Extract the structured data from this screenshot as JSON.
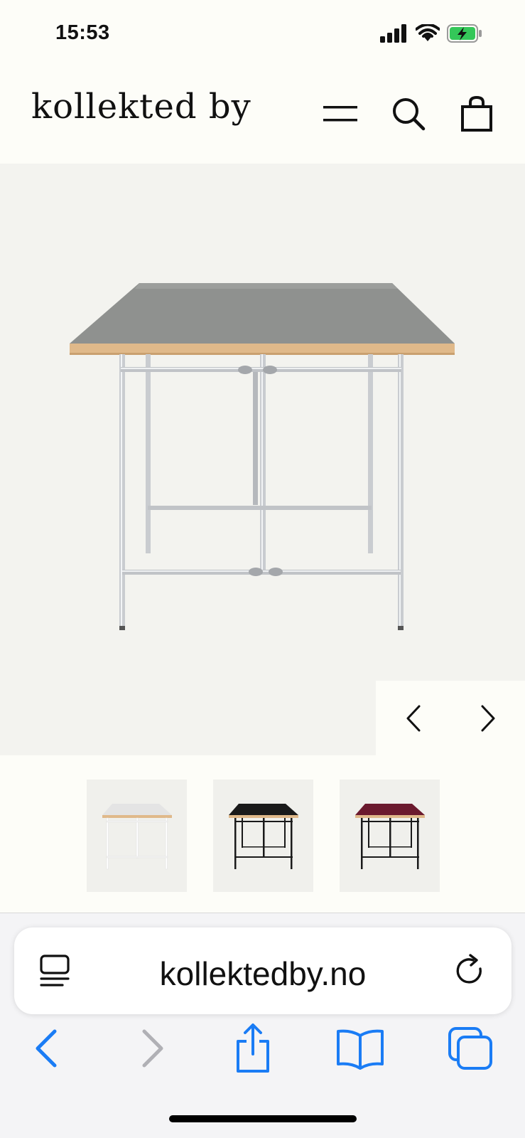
{
  "status_bar": {
    "time": "15:53",
    "icons": [
      "signal-icon",
      "wifi-icon",
      "battery-charging-icon"
    ]
  },
  "header": {
    "logo": "kollekted by",
    "icons": [
      "menu-icon",
      "search-icon",
      "shopping-bag-icon"
    ]
  },
  "gallery": {
    "prev_icon": "chevron-left-icon",
    "next_icon": "chevron-right-icon",
    "thumbnails": [
      {
        "label": "white-table",
        "top_color": "#e6e6e6",
        "frame_color": "#ffffff"
      },
      {
        "label": "black-table",
        "top_color": "#1a1a1a",
        "frame_color": "#1a1a1a"
      },
      {
        "label": "burgundy-table",
        "top_color": "#6b1a2e",
        "frame_color": "#1a1a1a"
      }
    ]
  },
  "browser": {
    "url": "kollektedby.no",
    "left_icon": "reader-icon",
    "right_icon": "reload-icon",
    "toolbar": [
      "back-icon",
      "forward-icon",
      "share-icon",
      "bookmarks-icon",
      "tabs-icon"
    ]
  },
  "colors": {
    "accent": "#1a7cf5",
    "disabled": "#b0b0b5",
    "page_bg": "#fdfdf8",
    "hero_bg": "#f3f3ef"
  }
}
